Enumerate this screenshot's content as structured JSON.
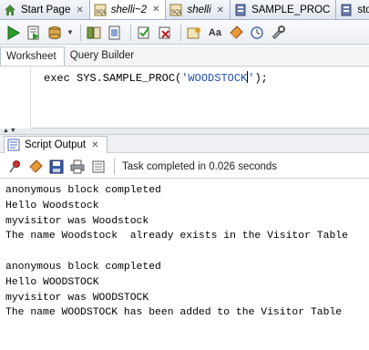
{
  "doc_tabs": [
    {
      "label": "Start Page",
      "italic": false,
      "closable": true
    },
    {
      "label": "shelli~2",
      "italic": true,
      "closable": true
    },
    {
      "label": "shelli",
      "italic": true,
      "closable": true
    },
    {
      "label": "SAMPLE_PROC",
      "italic": false,
      "closable": false
    },
    {
      "label": "sto",
      "italic": false,
      "closable": false
    }
  ],
  "toolbar_icons": [
    "run-icon",
    "run-script-icon",
    "commit-icon",
    "dropdown-icon",
    "explain-plan-icon",
    "autotrace-icon",
    "commit-icon",
    "rollback-icon",
    "sql-tuning-icon",
    "format-icon",
    "clear-icon",
    "history-icon",
    "tools-icon"
  ],
  "editor_tabs": {
    "worksheet": "Worksheet",
    "query_builder": "Query Builder"
  },
  "editor": {
    "code_prefix": "exec SYS.SAMPLE_PROC(",
    "code_string_before_caret": "'WOODSTOCK",
    "code_string_after_caret": "'",
    "code_suffix": ");"
  },
  "output_panel": {
    "tab_label": "Script Output",
    "status": "Task completed in 0.026 seconds",
    "lines": [
      "anonymous block completed",
      "Hello Woodstock",
      "myvisitor was Woodstock",
      "The name Woodstock  already exists in the Visitor Table",
      "",
      "anonymous block completed",
      "Hello WOODSTOCK",
      "myvisitor was WOODSTOCK",
      "The name WOODSTOCK has been added to the Visitor Table"
    ]
  },
  "colors": {
    "string_literal": "#1f4fb0",
    "run_green": "#2a9d2a",
    "tab_active_bg": "#ffffff"
  }
}
